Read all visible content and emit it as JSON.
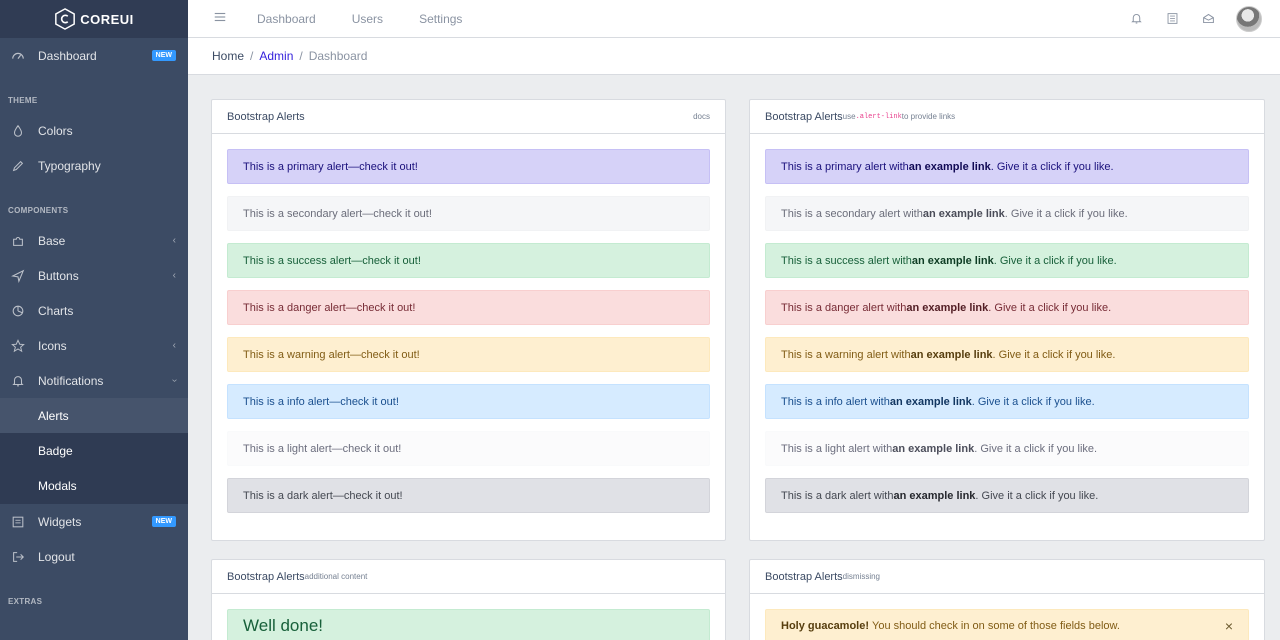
{
  "brand": {
    "name": "COREUI"
  },
  "sidebar": {
    "items": [
      {
        "label": "Dashboard",
        "badge": "NEW",
        "icon": "speedometer-icon"
      },
      {
        "section": "THEME"
      },
      {
        "label": "Colors",
        "icon": "drop-icon"
      },
      {
        "label": "Typography",
        "icon": "pencil-icon"
      },
      {
        "section": "COMPONENTS"
      },
      {
        "label": "Base",
        "icon": "puzzle-icon",
        "chevron": "‹"
      },
      {
        "label": "Buttons",
        "icon": "cursor-icon",
        "chevron": "‹"
      },
      {
        "label": "Charts",
        "icon": "chart-pie-icon"
      },
      {
        "label": "Icons",
        "icon": "star-icon",
        "chevron": "‹"
      },
      {
        "label": "Notifications",
        "icon": "bell-icon",
        "chevron": "›"
      },
      {
        "label": "Alerts"
      },
      {
        "label": "Badge"
      },
      {
        "label": "Modals"
      },
      {
        "label": "Widgets",
        "badge": "NEW",
        "icon": "calculator-icon"
      },
      {
        "label": "Logout",
        "icon": "account-logout-icon"
      },
      {
        "section": "EXTRAS"
      }
    ]
  },
  "header": {
    "nav": [
      "Dashboard",
      "Users",
      "Settings"
    ]
  },
  "breadcrumb": [
    "Home",
    "Admin",
    "Dashboard"
  ],
  "cards": {
    "basic": {
      "title": "Bootstrap Alerts",
      "right": "docs",
      "alerts": [
        "This is a primary alert—check it out!",
        "This is a secondary alert—check it out!",
        "This is a success alert—check it out!",
        "This is a danger alert—check it out!",
        "This is a warning alert—check it out!",
        "This is a info alert—check it out!",
        "This is a light alert—check it out!",
        "This is a dark alert—check it out!"
      ]
    },
    "links": {
      "title": "Bootstrap Alerts",
      "small_pre": "use ",
      "code": ".alert-link",
      "small_post": " to provide links",
      "link_text": "an example link",
      "suffix": ". Give it a click if you like.",
      "prefixes": [
        "This is a primary alert with",
        "This is a secondary alert with",
        "This is a success alert with",
        "This is a danger alert with",
        "This is a warning alert with",
        "This is a info alert with",
        "This is a light alert with",
        "This is a dark alert with"
      ]
    },
    "additional": {
      "title": "Bootstrap Alerts",
      "small": "additional content",
      "heading": "Well done!"
    },
    "dismissing": {
      "title": "Bootstrap Alerts",
      "small": "dismissing",
      "strong": "Holy guacamole!",
      "text": "You should check in on some of those fields below.",
      "close": "×"
    }
  },
  "colors": {
    "sidebar": "#3c4b64",
    "brand_bg": "#303c54",
    "primary": "#321fdb",
    "badge_info": "#3399ff"
  }
}
